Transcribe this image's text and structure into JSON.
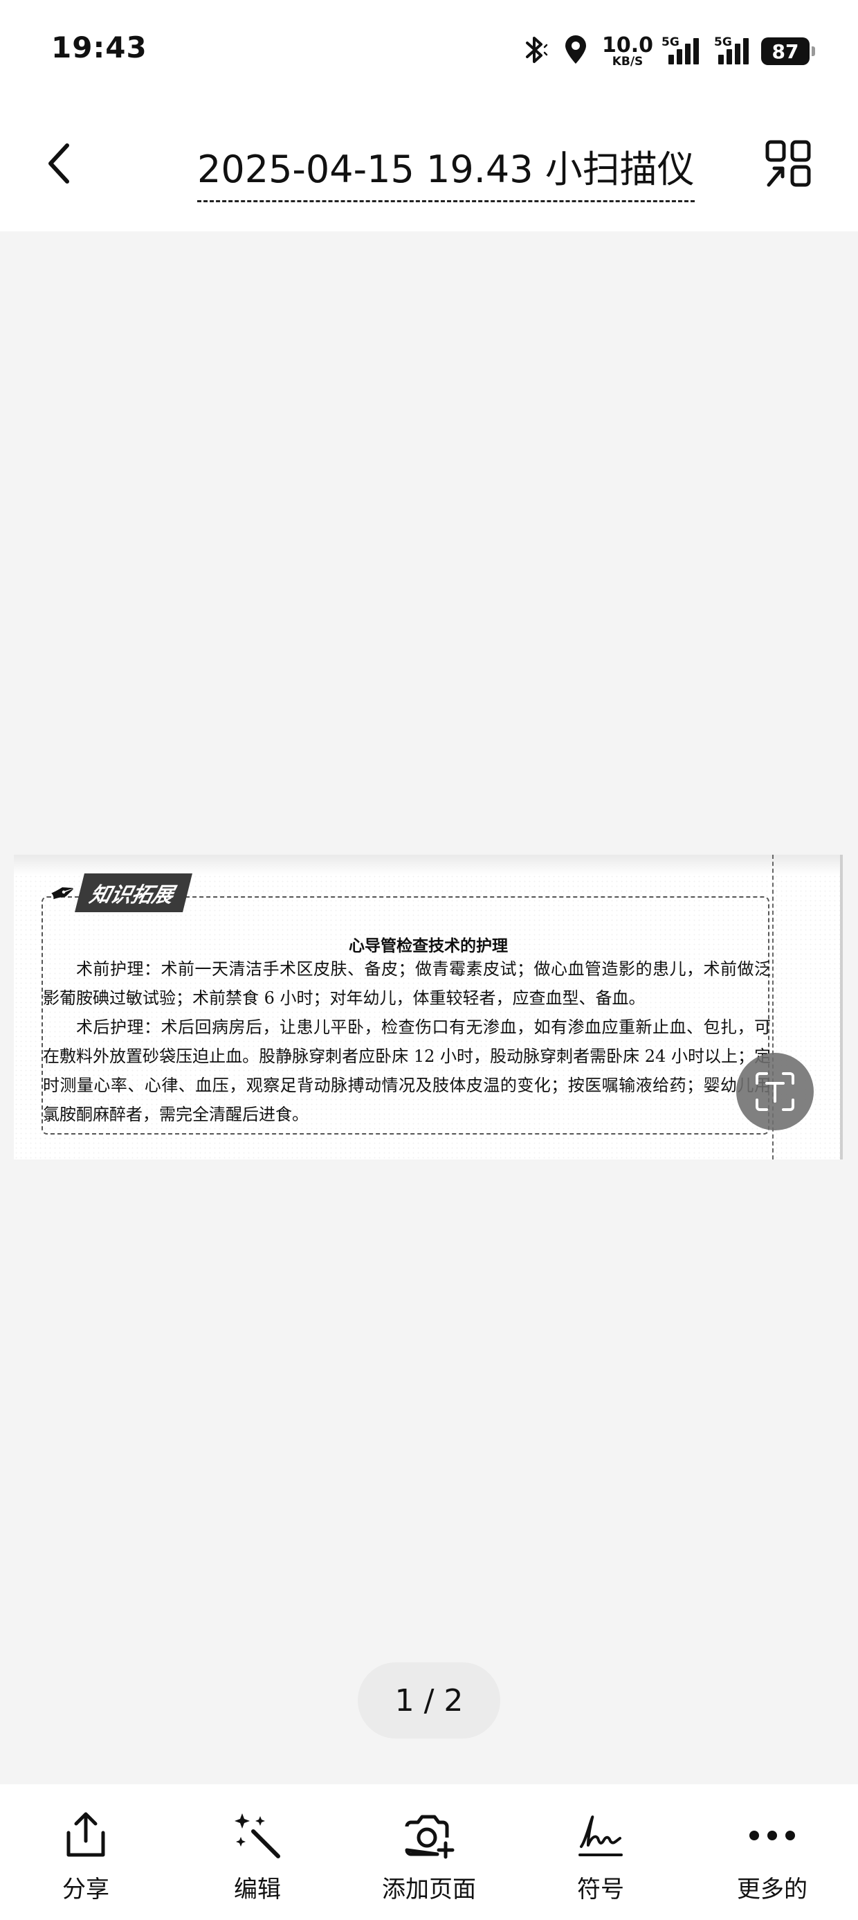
{
  "status_bar": {
    "time": "19:43",
    "net_speed_value": "10.0",
    "net_speed_unit": "KB/S",
    "signal1_label": "5G",
    "signal2_label": "5G",
    "battery": "87",
    "icons": [
      "bluetooth-icon",
      "location-icon",
      "signal-icon",
      "battery-icon"
    ]
  },
  "header": {
    "title": "2025-04-15 19.43 小扫描仪",
    "back_icon": "chevron-left-icon",
    "menu_icon": "grid-icon"
  },
  "document": {
    "badge": "知识拓展",
    "heading": "心导管检查技术的护理",
    "paragraph_1": "术前护理：术前一天清洁手术区皮肤、备皮；做青霉素皮试；做心血管造影的患儿，术前做泛影葡胺碘过敏试验；术前禁食 6 小时；对年幼儿，体重较轻者，应查血型、备血。",
    "paragraph_2": "术后护理：术后回病房后，让患儿平卧，检查伤口有无渗血，如有渗血应重新止血、包扎，可在敷料外放置砂袋压迫止血。股静脉穿刺者应卧床 12 小时，股动脉穿刺者需卧床 24 小时以上；定时测量心率、心律、血压，观察足背动脉搏动情况及肢体皮温的变化；按医嘱输液给药；婴幼儿用氯胺酮麻醉者，需完全清醒后进食。"
  },
  "ocr_button_icon": "text-scan-icon",
  "pager": {
    "current": "1",
    "total": "2",
    "text": "1 / 2"
  },
  "toolbar": [
    {
      "label": "分享",
      "icon": "share-icon"
    },
    {
      "label": "编辑",
      "icon": "magic-wand-icon"
    },
    {
      "label": "添加页面",
      "icon": "add-camera-icon"
    },
    {
      "label": "符号",
      "icon": "signature-icon"
    },
    {
      "label": "更多的",
      "icon": "more-icon"
    }
  ]
}
